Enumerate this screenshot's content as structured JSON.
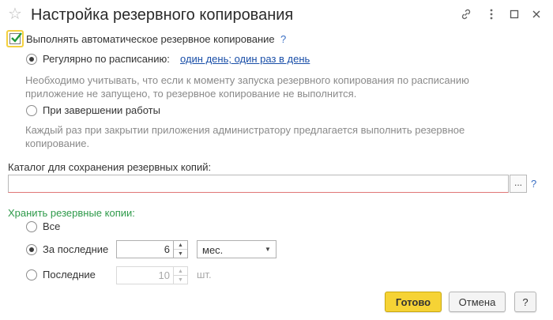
{
  "window": {
    "title": "Настройка резервного копирования"
  },
  "auto_backup": {
    "checkbox_label": "Выполнять автоматическое резервное копирование",
    "help": "?",
    "checked": true
  },
  "schedule": {
    "option_label": "Регулярно по расписанию:",
    "link": "один день; один раз в день",
    "note_line1": "Необходимо учитывать, что если к моменту запуска резервного копирования по расписанию",
    "note_line2": "приложение не запущено, то резервное копирование не выполнится."
  },
  "on_exit": {
    "option_label": "При завершении работы",
    "note_line1": "Каждый раз при закрытии приложения администратору предлагается выполнить резервное",
    "note_line2": "копирование."
  },
  "catalog": {
    "label": "Каталог для сохранения резервных копий:",
    "value": "",
    "browse": "...",
    "help": "?"
  },
  "retention": {
    "section_title": "Хранить резервные копии:",
    "all_label": "Все",
    "last_period_label": "За последние",
    "period_value": "6",
    "period_unit": "мес.",
    "last_count_label": "Последние",
    "count_value": "10",
    "count_unit": "шт."
  },
  "footer": {
    "ok_label": "Готово",
    "cancel_label": "Отмена",
    "help_label": "?"
  },
  "colors": {
    "primary_button": "#f6d335",
    "section_title": "#2e9a4a",
    "link": "#1a4fa8",
    "checkbox_check": "#1f9a3a"
  }
}
